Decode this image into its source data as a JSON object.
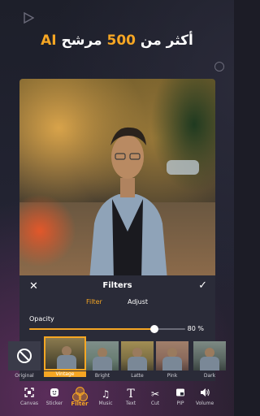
{
  "headline": {
    "text_before": "أكثر من ",
    "number": "500",
    "text_after": " مرشح ",
    "accent": "AI"
  },
  "editor": {
    "title": "Filters",
    "tabs": [
      "Filter",
      "Adjust"
    ],
    "active_tab": "Filter",
    "opacity": {
      "label": "Opacity",
      "value_text": "80 %",
      "value": 80
    }
  },
  "filters": [
    {
      "name": "Original",
      "icon": "ban-icon"
    },
    {
      "name": "Vintage",
      "selected": true
    },
    {
      "name": "Bright"
    },
    {
      "name": "Latte"
    },
    {
      "name": "Pink"
    },
    {
      "name": "Dark"
    }
  ],
  "toolbar": [
    {
      "label": "Canvas",
      "icon": "canvas-icon"
    },
    {
      "label": "Sticker",
      "icon": "sticker-icon"
    },
    {
      "label": "Filter",
      "icon": "filter-icon",
      "active": true
    },
    {
      "label": "Music",
      "icon": "music-icon"
    },
    {
      "label": "Text",
      "icon": "text-icon"
    },
    {
      "label": "Cut",
      "icon": "scissors-icon"
    },
    {
      "label": "PIP",
      "icon": "pip-icon"
    },
    {
      "label": "Volume",
      "icon": "volume-icon"
    }
  ],
  "colors": {
    "accent": "#f6a623",
    "background": "#1c1c26",
    "panel": "#2a2b38"
  }
}
